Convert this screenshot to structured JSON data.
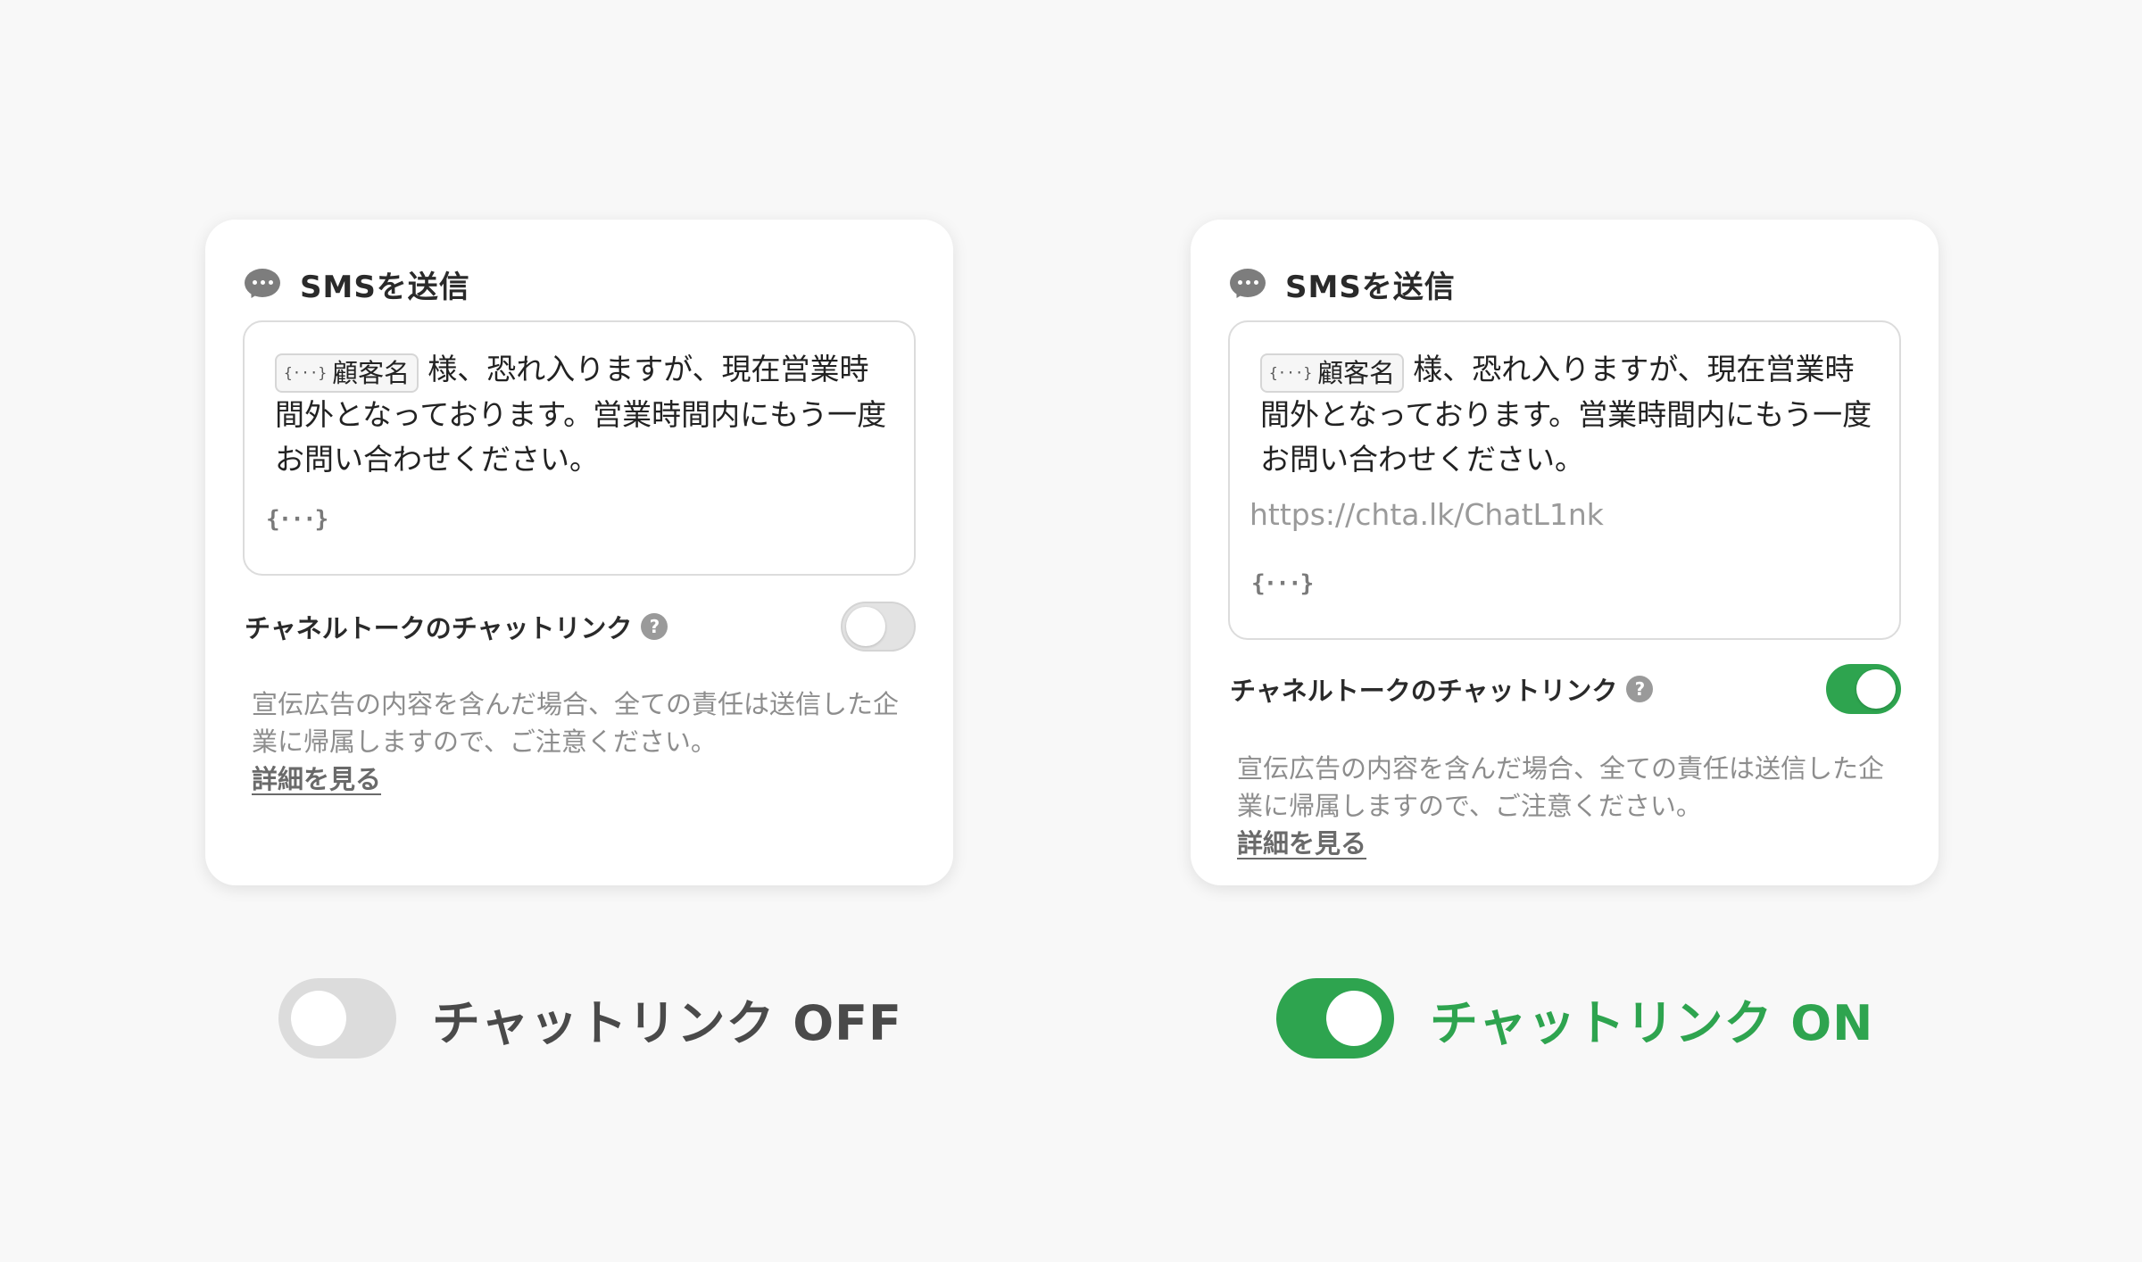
{
  "colors": {
    "background": "#f8f8f8",
    "on": "#2ea44f",
    "off": "#dcdcdc"
  },
  "cards": [
    {
      "title": "SMSを送信",
      "variable_chip": "顧客名",
      "message": "様、恐れ入りますが、現在営業時間外となっております。営業時間内にもう一度お問い合わせください。",
      "link_url": "",
      "brace_symbol": "{···}",
      "link_label": "チャネルトークのチャットリンク",
      "help_symbol": "?",
      "toggle_state": "off",
      "notice": "宣伝広告の内容を含んだ場合、全ての責任は送信した企業に帰属しますので、ご注意ください。",
      "detail_link": "詳細を見る"
    },
    {
      "title": "SMSを送信",
      "variable_chip": "顧客名",
      "message": "様、恐れ入りますが、現在営業時間外となっております。営業時間内にもう一度お問い合わせください。",
      "link_url": "https://chta.lk/ChatL1nk",
      "brace_symbol": "{···}",
      "link_label": "チャネルトークのチャットリンク",
      "help_symbol": "?",
      "toggle_state": "on",
      "notice": "宣伝広告の内容を含んだ場合、全ての責任は送信した企業に帰属しますので、ご注意ください。",
      "detail_link": "詳細を見る"
    }
  ],
  "captions": [
    {
      "label": "チャットリンク OFF",
      "toggle_state": "off"
    },
    {
      "label": "チャットリンク ON",
      "toggle_state": "on"
    }
  ]
}
